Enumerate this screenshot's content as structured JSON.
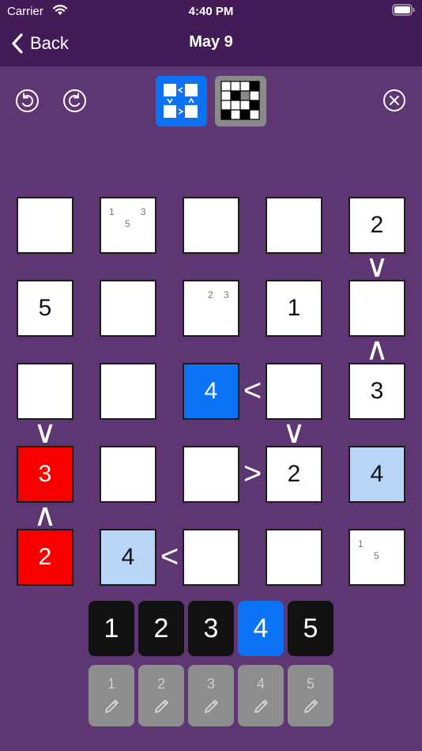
{
  "status_bar": {
    "carrier": "Carrier",
    "time": "4:40 PM"
  },
  "nav": {
    "back_label": "Back",
    "title": "May 9"
  },
  "grid": {
    "rows": [
      [
        {
          "value": "",
          "notes": [],
          "state": "normal"
        },
        {
          "value": "",
          "notes": [
            "1",
            "3",
            "5"
          ],
          "state": "normal"
        },
        {
          "value": "",
          "notes": [],
          "state": "normal"
        },
        {
          "value": "",
          "notes": [],
          "state": "normal"
        },
        {
          "value": "2",
          "notes": [],
          "state": "normal"
        }
      ],
      [
        {
          "value": "5",
          "notes": [],
          "state": "normal"
        },
        {
          "value": "",
          "notes": [],
          "state": "normal"
        },
        {
          "value": "",
          "notes": [
            "2",
            "3"
          ],
          "state": "normal"
        },
        {
          "value": "1",
          "notes": [],
          "state": "normal"
        },
        {
          "value": "",
          "notes": [],
          "state": "normal"
        }
      ],
      [
        {
          "value": "",
          "notes": [],
          "state": "normal"
        },
        {
          "value": "",
          "notes": [],
          "state": "normal"
        },
        {
          "value": "4",
          "notes": [],
          "state": "selected"
        },
        {
          "value": "",
          "notes": [],
          "state": "normal"
        },
        {
          "value": "3",
          "notes": [],
          "state": "normal"
        }
      ],
      [
        {
          "value": "3",
          "notes": [],
          "state": "error"
        },
        {
          "value": "",
          "notes": [],
          "state": "normal"
        },
        {
          "value": "",
          "notes": [],
          "state": "normal"
        },
        {
          "value": "2",
          "notes": [],
          "state": "normal"
        },
        {
          "value": "4",
          "notes": [],
          "state": "highlight"
        }
      ],
      [
        {
          "value": "2",
          "notes": [],
          "state": "error"
        },
        {
          "value": "4",
          "notes": [],
          "state": "highlight"
        },
        {
          "value": "",
          "notes": [],
          "state": "normal"
        },
        {
          "value": "",
          "notes": [],
          "state": "normal"
        },
        {
          "value": "",
          "notes": [
            "1",
            "5"
          ],
          "state": "normal"
        }
      ]
    ],
    "inequalities": [
      {
        "between": "r0c4-r1c4",
        "symbol": "∨"
      },
      {
        "between": "r1c4-r2c4",
        "symbol": "∧"
      },
      {
        "between": "r2c2-r2c3",
        "symbol": "<"
      },
      {
        "between": "r2c0-r3c0",
        "symbol": "∨"
      },
      {
        "between": "r2c3-r3c3",
        "symbol": "∨"
      },
      {
        "between": "r3c2-r3c3",
        "symbol": ">"
      },
      {
        "between": "r3c0-r4c0",
        "symbol": "∧"
      },
      {
        "between": "r4c1-r4c2",
        "symbol": "<"
      }
    ]
  },
  "number_pad": [
    "1",
    "2",
    "3",
    "4",
    "5"
  ],
  "selected_number": "4",
  "notes_pad": [
    "1",
    "2",
    "3",
    "4",
    "5"
  ],
  "colors": {
    "background": "#5e3673",
    "header": "#431c57",
    "accent": "#0b72f4",
    "error": "#f70000",
    "highlight": "#b8d5f7"
  }
}
